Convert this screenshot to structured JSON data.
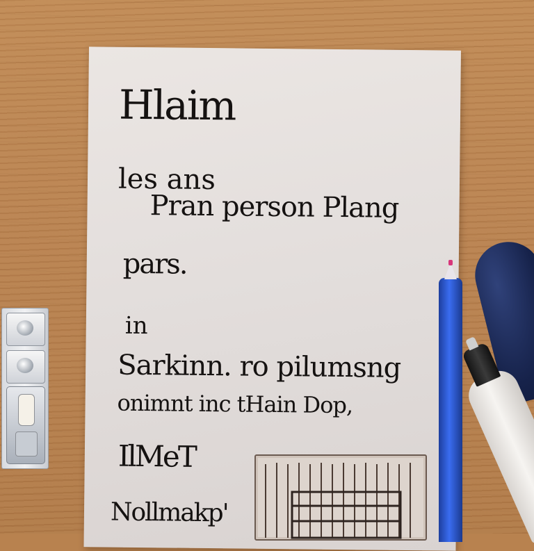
{
  "scene": {
    "description_colors": {
      "table": "#b8824f",
      "paper": "#e6e1df",
      "ink": "#151211",
      "pen_blue": "#2f5ce0",
      "handle_navy": "#16224a"
    }
  },
  "note": {
    "lines": [
      "Hlaim",
      "les ans",
      "Pran person Plang",
      "pars.",
      "in",
      "Sarkinn. ro pilumsng",
      "onimnt inc tHain Dop,",
      "IlMeT",
      "Nollmakp'"
    ]
  }
}
